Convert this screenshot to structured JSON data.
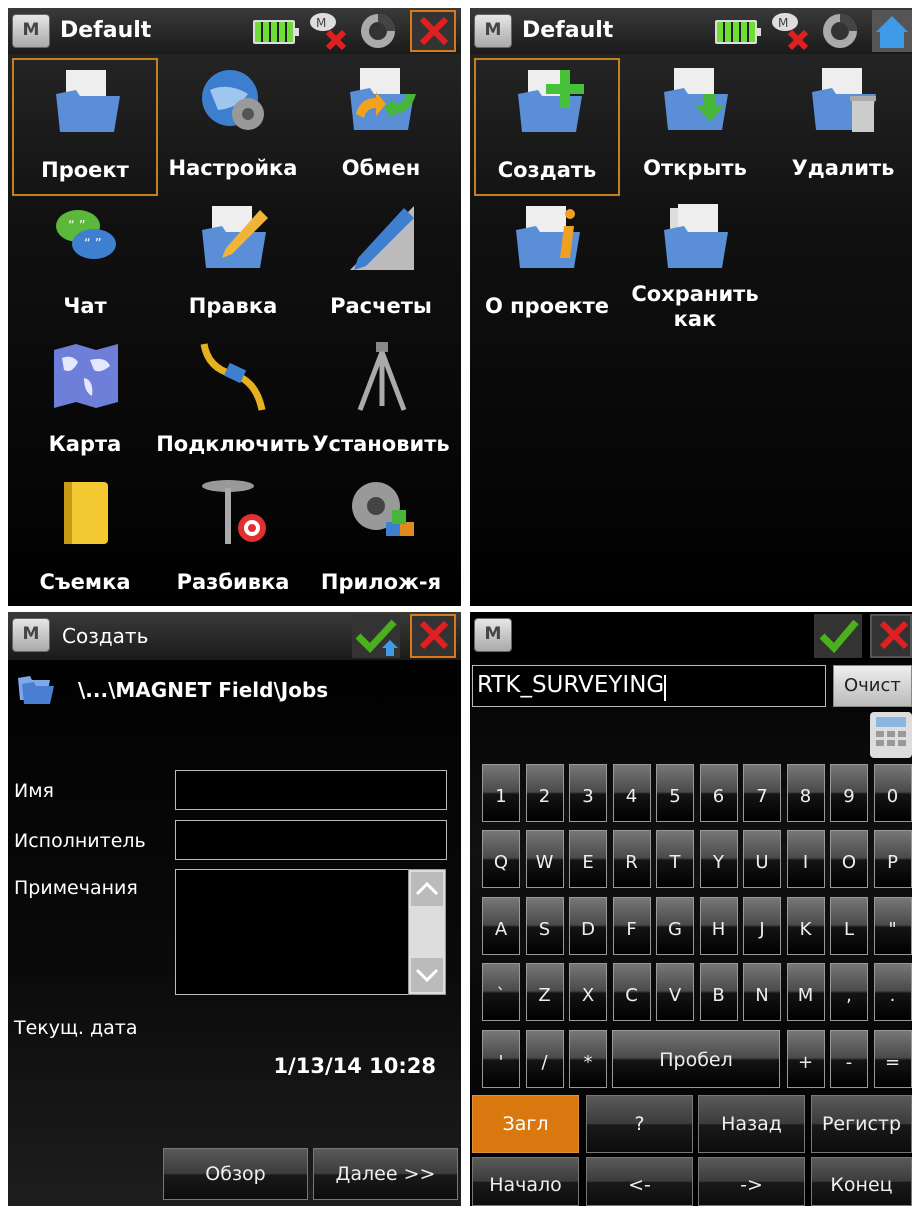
{
  "project_menu": {
    "title": "Default",
    "items": [
      {
        "label": "Проект",
        "icon": "folder-document-icon"
      },
      {
        "label": "Настройка",
        "icon": "globe-gear-icon"
      },
      {
        "label": "Обмен",
        "icon": "folder-exchange-icon"
      },
      {
        "label": "Чат",
        "icon": "chat-bubbles-icon"
      },
      {
        "label": "Правка",
        "icon": "folder-pencil-icon"
      },
      {
        "label": "Расчеты",
        "icon": "pencil-ruler-icon"
      },
      {
        "label": "Карта",
        "icon": "world-map-icon"
      },
      {
        "label": "Подключить",
        "icon": "cable-plug-icon"
      },
      {
        "label": "Установить",
        "icon": "tripod-icon"
      },
      {
        "label": "Съемка",
        "icon": "fieldbook-icon"
      },
      {
        "label": "Разбивка",
        "icon": "stake-target-icon"
      },
      {
        "label": "Прилож-я",
        "icon": "gear-blocks-icon"
      }
    ]
  },
  "job_menu": {
    "title": "Default",
    "items": [
      {
        "label": "Создать",
        "icon": "folder-add-icon"
      },
      {
        "label": "Открыть",
        "icon": "folder-open-icon"
      },
      {
        "label": "Удалить",
        "icon": "folder-delete-icon"
      },
      {
        "label": "О проекте",
        "icon": "folder-info-icon"
      },
      {
        "label": "Сохранить как",
        "icon": "folder-saveas-icon"
      }
    ]
  },
  "create_dialog": {
    "title": "Создать",
    "path": "\\...\\MAGNET Field\\Jobs",
    "name_label": "Имя",
    "name_value": "",
    "operator_label": "Исполнитель",
    "operator_value": "",
    "notes_label": "Примечания",
    "notes_value": "",
    "date_label": "Текущ. дата",
    "date_value": "1/13/14 10:28",
    "browse_label": "Обзор",
    "next_label": "Далее >>"
  },
  "keyboard": {
    "input_value": "RTK_SURVEYING",
    "clear_label": "Очист",
    "rows": [
      [
        "1",
        "2",
        "3",
        "4",
        "5",
        "6",
        "7",
        "8",
        "9",
        "0"
      ],
      [
        "Q",
        "W",
        "E",
        "R",
        "T",
        "Y",
        "U",
        "I",
        "O",
        "P"
      ],
      [
        "A",
        "S",
        "D",
        "F",
        "G",
        "H",
        "J",
        "K",
        "L",
        "\""
      ],
      [
        "`",
        "Z",
        "X",
        "C",
        "V",
        "B",
        "N",
        "M",
        ",",
        "."
      ]
    ],
    "row5_left": [
      "'",
      "/",
      "*"
    ],
    "space_label": "Пробел",
    "row5_right": [
      "+",
      "-",
      "="
    ],
    "caps_label": "Загл",
    "question_label": "?",
    "back_label": "Назад",
    "shift_label": "Регистр",
    "home_label": "Начало",
    "left_label": "<-",
    "right_label": "->",
    "end_label": "Конец"
  },
  "colors": {
    "accent_orange": "#c2801e",
    "caps_active": "#d9780f",
    "cancel_red": "#e02020",
    "ok_green": "#4caf1e"
  }
}
